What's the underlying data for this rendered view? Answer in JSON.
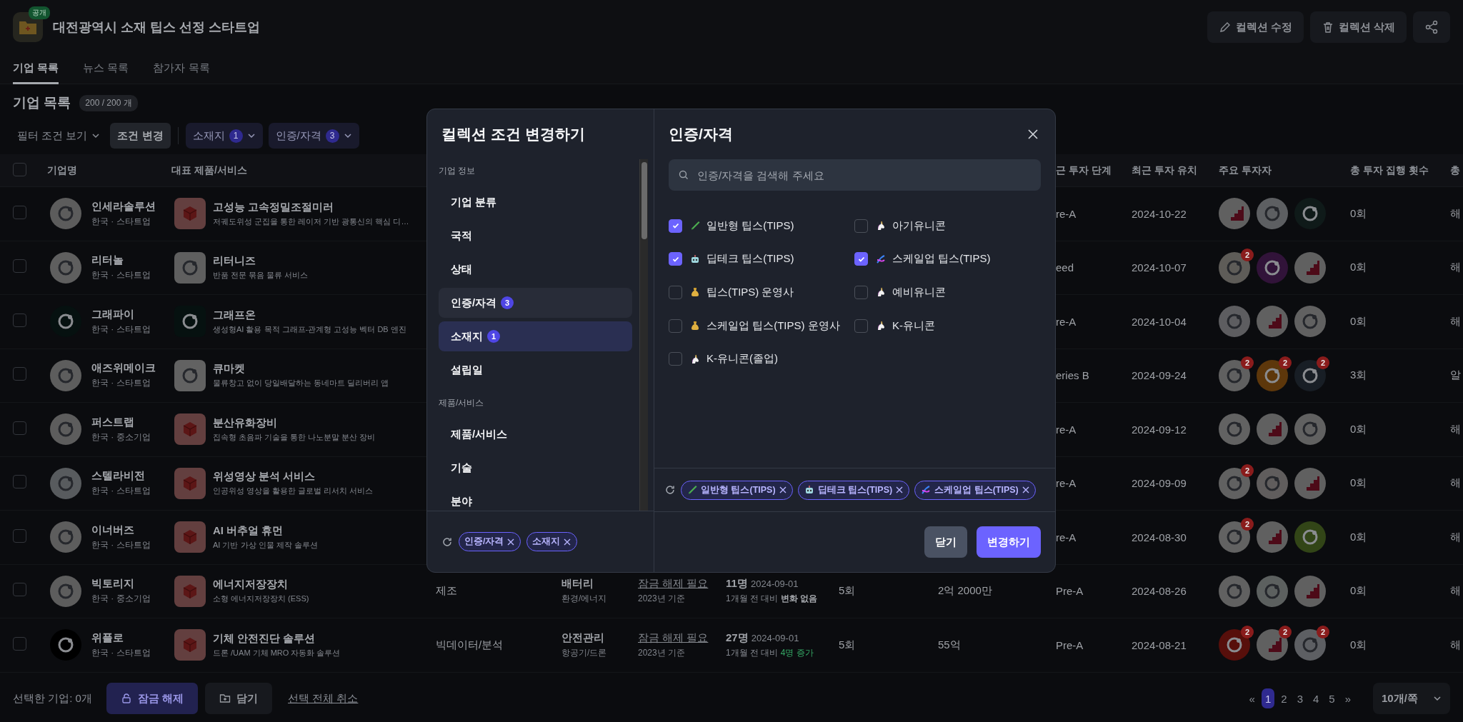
{
  "header": {
    "badge": "공개",
    "title": "대전광역시 소재 팁스 선정 스타트업",
    "actions": [
      {
        "kind": "edit",
        "label": "컬렉션 수정"
      },
      {
        "kind": "delete",
        "label": "컬렉션 삭제"
      },
      {
        "kind": "share"
      }
    ]
  },
  "tabs": [
    {
      "label": "기업 목록",
      "selected": true
    },
    {
      "label": "뉴스 목록",
      "selected": false
    },
    {
      "label": "참가자 목록",
      "selected": false
    }
  ],
  "list": {
    "title": "기업 목록",
    "count": "200 / 200 개"
  },
  "filters": {
    "view": "필터 조건 보기",
    "change": "조건 변경",
    "chips": [
      {
        "label": "소재지",
        "count": "1"
      },
      {
        "label": "인증/자격",
        "count": "3"
      }
    ]
  },
  "table": {
    "all_checked": false,
    "columns": [
      {
        "kind": "company",
        "label": "기업명"
      },
      {
        "kind": "product",
        "label": "대표 제품/서비스"
      },
      {
        "kind": "stage",
        "label": "근 투자 단계"
      },
      {
        "kind": "date",
        "label": "최근 투자 유치"
      },
      {
        "kind": "investors",
        "label": "주요 투자자"
      },
      {
        "kind": "count",
        "label": "총 투자 집행 횟수"
      },
      {
        "kind": "cut",
        "label": "총"
      }
    ],
    "rows": [
      {
        "checked": false,
        "cells": [
          {
            "kind": "company",
            "name": "인세라솔루션",
            "meta": "한국 · 스타트업",
            "color": "#5c5c5c"
          },
          {
            "kind": "product",
            "logo": {
              "kind": "cube"
            },
            "name": "고성능 고속정밀조절미러",
            "desc": "저궤도위성 군집을 통한 레이저 기반 광통신의 핵심 디…"
          },
          {
            "kind": "stage",
            "text": "re-A"
          },
          {
            "kind": "date",
            "text": "2024-10-22"
          },
          {
            "kind": "investors",
            "items": [
              {
                "kind": "tips"
              },
              {
                "kind": "logo",
                "color": "#5d5f62"
              },
              {
                "kind": "logo",
                "color": "#0f1a19"
              }
            ]
          },
          {
            "kind": "count",
            "text": "0회"
          },
          {
            "kind": "cut",
            "text": "해"
          }
        ]
      },
      {
        "checked": false,
        "cells": [
          {
            "kind": "company",
            "name": "리터놀",
            "meta": "한국 · 스타트업",
            "color": "#5f5f5f"
          },
          {
            "kind": "product",
            "logo": {
              "kind": "logo",
              "color": "#5f5f5f"
            },
            "name": "리터니즈",
            "desc": "반품 전문 묶음 물류 서비스"
          },
          {
            "kind": "stage",
            "text": "eed"
          },
          {
            "kind": "date",
            "text": "2024-10-07"
          },
          {
            "kind": "investors",
            "items": [
              {
                "kind": "logo",
                "color": "#5e5c58",
                "badge": "2"
              },
              {
                "kind": "logo",
                "color": "#311339"
              },
              {
                "kind": "tips"
              }
            ]
          },
          {
            "kind": "count",
            "text": "0회"
          },
          {
            "kind": "cut",
            "text": "해"
          }
        ]
      },
      {
        "checked": false,
        "cells": [
          {
            "kind": "company",
            "name": "그래파이",
            "meta": "한국 · 스타트업",
            "color": "#061110"
          },
          {
            "kind": "product",
            "logo": {
              "kind": "logo",
              "color": "#061110"
            },
            "name": "그래프온",
            "desc": "생성형AI 활용 목적 그래프-관계형 고성능 벡터 DB 엔진"
          },
          {
            "kind": "stage",
            "text": "re-A"
          },
          {
            "kind": "date",
            "text": "2024-10-04"
          },
          {
            "kind": "investors",
            "items": [
              {
                "kind": "logo",
                "color": "#5d5d60"
              },
              {
                "kind": "tips"
              },
              {
                "kind": "logo",
                "color": "#616161"
              }
            ]
          },
          {
            "kind": "count",
            "text": "0회"
          },
          {
            "kind": "cut",
            "text": "해"
          }
        ]
      },
      {
        "checked": false,
        "cells": [
          {
            "kind": "company",
            "name": "애즈위메이크",
            "meta": "한국 · 스타트업",
            "color": "#5d5d5d"
          },
          {
            "kind": "product",
            "logo": {
              "kind": "logo",
              "color": "#626262"
            },
            "name": "큐마켓",
            "desc": "물류창고 없이 당일배달하는 동네마트 딜리버리 앱"
          },
          {
            "kind": "stage",
            "text": "eries B"
          },
          {
            "kind": "date",
            "text": "2024-09-24"
          },
          {
            "kind": "investors",
            "items": [
              {
                "kind": "logo",
                "color": "#606060",
                "badge": "2"
              },
              {
                "kind": "logo",
                "color": "#5d370b",
                "badge": "2"
              },
              {
                "kind": "logo",
                "color": "#181e25",
                "badge": "2"
              }
            ]
          },
          {
            "kind": "count",
            "text": "3회"
          },
          {
            "kind": "cut",
            "text": "알"
          }
        ]
      },
      {
        "checked": false,
        "cells": [
          {
            "kind": "company",
            "name": "퍼스트랩",
            "meta": "한국 · 중소기업",
            "color": "#5d5d5d"
          },
          {
            "kind": "product",
            "logo": {
              "kind": "cube"
            },
            "name": "분산유화장비",
            "desc": "집속형 초음파 기술을 통한 나노분말 분산 장비"
          },
          {
            "kind": "stage",
            "text": "re-A"
          },
          {
            "kind": "date",
            "text": "2024-09-12"
          },
          {
            "kind": "investors",
            "items": [
              {
                "kind": "logo",
                "color": "#626262"
              },
              {
                "kind": "tips"
              },
              {
                "kind": "logo",
                "color": "#616161"
              }
            ]
          },
          {
            "kind": "count",
            "text": "0회"
          },
          {
            "kind": "cut",
            "text": "해"
          }
        ]
      },
      {
        "checked": false,
        "cells": [
          {
            "kind": "company",
            "name": "스텔라비전",
            "meta": "한국 · 스타트업",
            "color": "#585b5e"
          },
          {
            "kind": "product",
            "logo": {
              "kind": "cube"
            },
            "name": "위성영상 분석 서비스",
            "desc": "인공위성 영상을 활용한 글로벌 리서치 서비스"
          },
          {
            "kind": "stage",
            "text": "re-A"
          },
          {
            "kind": "date",
            "text": "2024-09-09"
          },
          {
            "kind": "investors",
            "items": [
              {
                "kind": "logo",
                "color": "#616161",
                "badge": "2"
              },
              {
                "kind": "logo",
                "color": "#605d5d"
              },
              {
                "kind": "tips"
              }
            ]
          },
          {
            "kind": "count",
            "text": "0회"
          },
          {
            "kind": "cut",
            "text": "해"
          }
        ]
      },
      {
        "checked": false,
        "cells": [
          {
            "kind": "company",
            "name": "이너버즈",
            "meta": "한국 · 스타트업",
            "color": "#5d5d5d"
          },
          {
            "kind": "product",
            "logo": {
              "kind": "cube"
            },
            "name": "AI 버추얼 휴먼",
            "desc": "AI 기반 가상 인물 제작 솔루션"
          },
          {
            "kind": "stage",
            "text": "re-A"
          },
          {
            "kind": "date",
            "text": "2024-08-30"
          },
          {
            "kind": "investors",
            "items": [
              {
                "kind": "logo",
                "color": "#626262",
                "badge": "2"
              },
              {
                "kind": "tips"
              },
              {
                "kind": "logo",
                "color": "#324517"
              }
            ]
          },
          {
            "kind": "count",
            "text": "0회"
          },
          {
            "kind": "cut",
            "text": "해"
          }
        ]
      },
      {
        "checked": false,
        "cells": [
          {
            "kind": "company",
            "name": "빅토리지",
            "meta": "한국 · 중소기업",
            "color": "#5d5d5d"
          },
          {
            "kind": "product",
            "logo": {
              "kind": "cube"
            },
            "name": "에너지저장장치",
            "desc": "소형 에너지저장장치 (ESS)"
          },
          {
            "kind": "sector",
            "text": "제조"
          },
          {
            "kind": "field",
            "main": "배터리",
            "sub": "환경/에너지"
          },
          {
            "kind": "revenue",
            "link": "잠금 해제 필요",
            "sub": "2023년 기준"
          },
          {
            "kind": "employees",
            "count": "11명",
            "date": "2024-09-01",
            "prefix": "1개월 전 대비",
            "change": "변화 없음",
            "increased": false
          },
          {
            "kind": "rounds",
            "text": "5회"
          },
          {
            "kind": "amount",
            "text": "2억 2000만"
          },
          {
            "kind": "stage",
            "text": "Pre-A"
          },
          {
            "kind": "date",
            "text": "2024-08-26"
          },
          {
            "kind": "investors",
            "items": [
              {
                "kind": "logo",
                "color": "#616161"
              },
              {
                "kind": "logo",
                "color": "#5c605f"
              },
              {
                "kind": "tips"
              }
            ]
          },
          {
            "kind": "count",
            "text": "0회"
          },
          {
            "kind": "cut",
            "text": "해"
          }
        ]
      },
      {
        "checked": false,
        "cells": [
          {
            "kind": "company",
            "name": "위플로",
            "meta": "한국 · 스타트업",
            "color": "#000000"
          },
          {
            "kind": "product",
            "logo": {
              "kind": "cube"
            },
            "name": "기체 안전진단 솔루션",
            "desc": "드론 /UAM 기체 MRO 자동화 솔루션"
          },
          {
            "kind": "sector",
            "text": "빅데이터/분석"
          },
          {
            "kind": "field",
            "main": "안전관리",
            "sub": "항공기/드론"
          },
          {
            "kind": "revenue",
            "link": "잠금 해제 필요",
            "sub": "2023년 기준"
          },
          {
            "kind": "employees",
            "count": "27명",
            "date": "2024-09-01",
            "prefix": "1개월 전 대비",
            "change": "4명 증가",
            "increased": true
          },
          {
            "kind": "rounds",
            "text": "5회"
          },
          {
            "kind": "amount",
            "text": "55억"
          },
          {
            "kind": "stage",
            "text": "Pre-A"
          },
          {
            "kind": "date",
            "text": "2024-08-21"
          },
          {
            "kind": "investors",
            "items": [
              {
                "kind": "logo",
                "color": "#570f0b",
                "badge": "2"
              },
              {
                "kind": "tips",
                "badge": "2"
              },
              {
                "kind": "logo",
                "color": "#5d5f63",
                "badge": "2"
              }
            ]
          },
          {
            "kind": "count",
            "text": "0회"
          },
          {
            "kind": "cut",
            "text": "해"
          }
        ]
      }
    ]
  },
  "footer": {
    "selected": "선택한 기업: 0개",
    "unlock": "잠금 해제",
    "save": "담기",
    "clear": "선택 전체 취소",
    "pager": {
      "first": "«",
      "pages": [
        {
          "label": "1",
          "selected": true
        },
        {
          "label": "2",
          "selected": false
        },
        {
          "label": "3",
          "selected": false
        },
        {
          "label": "4",
          "selected": false
        },
        {
          "label": "5",
          "selected": false
        }
      ],
      "last": "»"
    },
    "page_size": "10개/쪽"
  },
  "modal": {
    "title": "컬렉션 조건 변경하기",
    "sections": [
      {
        "title": "기업 정보",
        "items": [
          {
            "label": "기업 분류",
            "selected": false,
            "open": false
          },
          {
            "label": "국적",
            "selected": false,
            "open": false
          },
          {
            "label": "상태",
            "selected": false,
            "open": false
          },
          {
            "label": "인증/자격",
            "count": "3",
            "selected": false,
            "open": true
          },
          {
            "label": "소재지",
            "count": "1",
            "selected": true,
            "open": false
          },
          {
            "label": "설립일",
            "selected": false,
            "open": false
          }
        ]
      },
      {
        "title": "제품/서비스",
        "items": [
          {
            "label": "제품/서비스",
            "selected": false,
            "open": false
          },
          {
            "label": "기술",
            "selected": false,
            "open": false
          },
          {
            "label": "분야",
            "selected": false,
            "open": false
          }
        ]
      }
    ],
    "applied": [
      {
        "label": "인증/자격"
      },
      {
        "label": "소재지"
      }
    ],
    "panel": {
      "title": "인증/자격",
      "search": {
        "placeholder": "인증/자격을 검색해 주세요"
      },
      "options": [
        {
          "kind": "tube",
          "label": "일반형 팁스(TIPS)",
          "checked": true
        },
        {
          "kind": "unicorn",
          "label": "아기유니콘",
          "checked": false
        },
        {
          "kind": "robot",
          "label": "딥테크 팁스(TIPS)",
          "checked": true
        },
        {
          "kind": "dna",
          "label": "스케일업 팁스(TIPS)",
          "checked": true
        },
        {
          "kind": "money",
          "label": "팁스(TIPS) 운영사",
          "checked": false
        },
        {
          "kind": "unicorn",
          "label": "예비유니콘",
          "checked": false
        },
        {
          "kind": "money",
          "label": "스케일업 팁스(TIPS) 운영사",
          "checked": false
        },
        {
          "kind": "unicorn",
          "label": "K-유니콘",
          "checked": false
        },
        {
          "kind": "unicorn",
          "label": "K-유니콘(졸업)",
          "checked": false
        }
      ],
      "chips": [
        {
          "kind": "tube",
          "label": "일반형 팁스(TIPS)"
        },
        {
          "kind": "robot",
          "label": "딥테크 팁스(TIPS)"
        },
        {
          "kind": "dna",
          "label": "스케일업 팁스(TIPS)"
        }
      ]
    },
    "buttons": [
      {
        "kind": "secondary",
        "label": "닫기"
      },
      {
        "kind": "primary",
        "label": "변경하기"
      }
    ]
  }
}
